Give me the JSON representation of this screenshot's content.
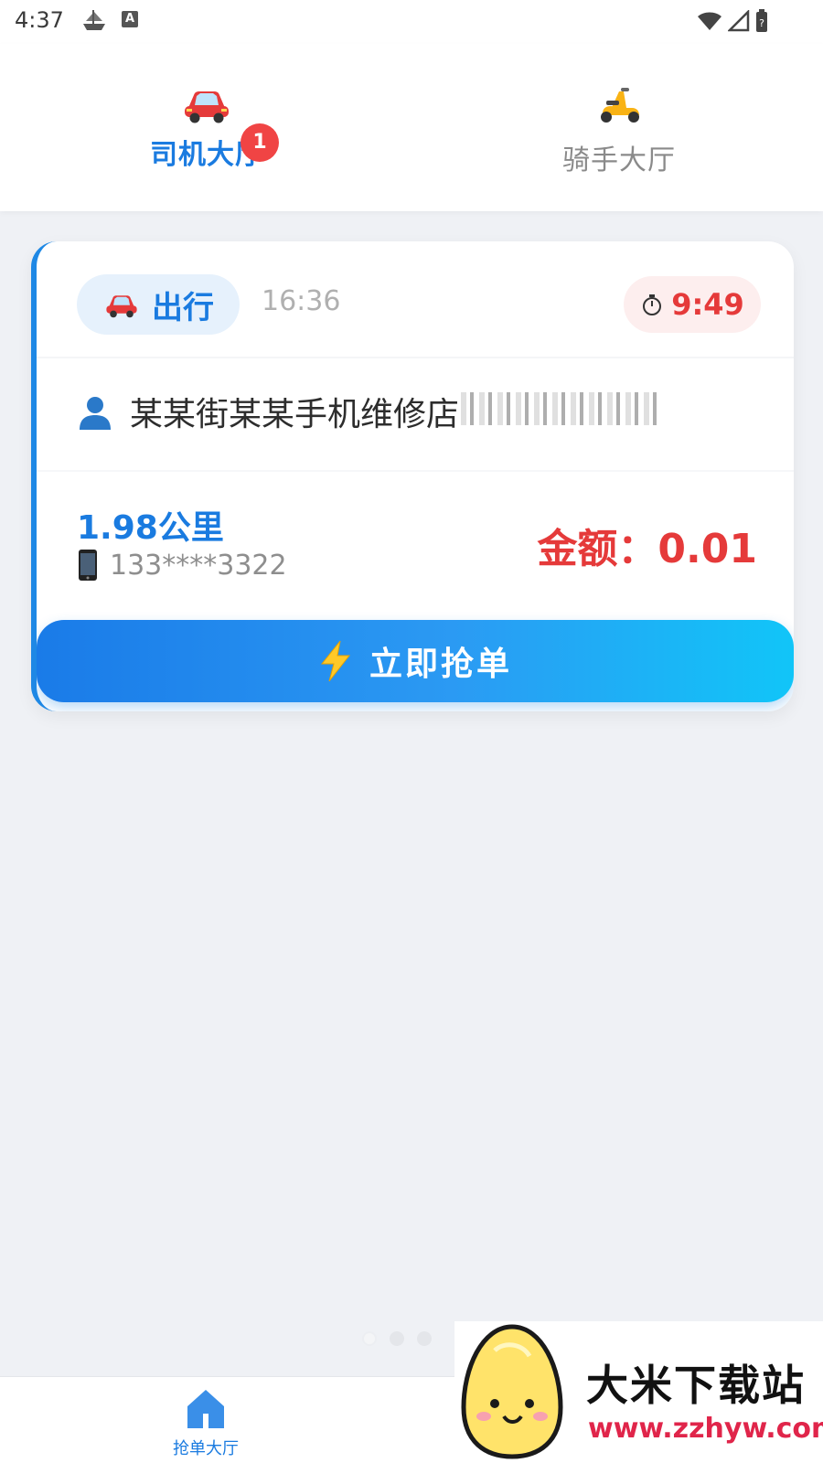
{
  "status_bar": {
    "time": "4:37",
    "app_icon_letter": "A"
  },
  "tabs": [
    {
      "label": "司机大厅",
      "active": true,
      "badge": "1",
      "icon": "car-icon"
    },
    {
      "label": "骑手大厅",
      "active": false,
      "icon": "scooter-icon"
    }
  ],
  "order": {
    "type_label": "出行",
    "type_icon": "car-icon",
    "created_time": "16:36",
    "countdown": "9:49",
    "customer_name": "某某街某某手机维修店",
    "distance": "1.98公里",
    "phone": "133****3322",
    "amount": "金额：0.01",
    "grab_button_label": "立即抢单"
  },
  "bottom_nav": {
    "items": [
      {
        "label": "抢单大厅",
        "icon": "home-icon",
        "active": true
      }
    ]
  },
  "watermark": {
    "title": "大米下载站",
    "url": "www.zzhyw.com"
  },
  "colors": {
    "primary": "#1a7be0",
    "danger": "#e53a3a",
    "background": "#eff1f5"
  }
}
